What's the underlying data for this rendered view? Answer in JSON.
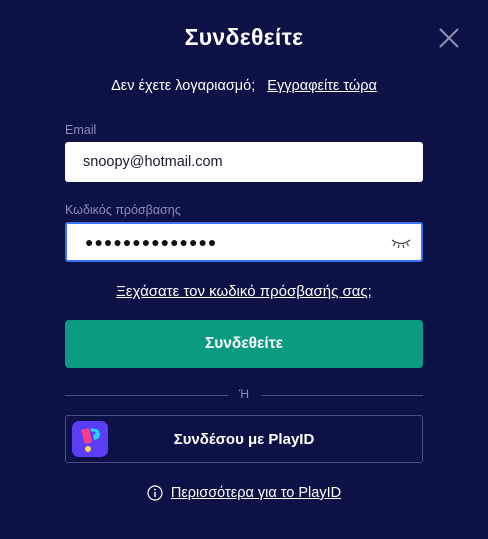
{
  "modal": {
    "title": "Συνδεθείτε",
    "close_icon": "close-icon"
  },
  "signup": {
    "question": "Δεν έχετε λογαριασμό;",
    "link": "Εγγραφείτε τώρα"
  },
  "email": {
    "label": "Email",
    "value": "snoopy@hotmail.com"
  },
  "password": {
    "label": "Κωδικός πρόσβασης",
    "masked_value": "●●●●●●●●●●●●●●",
    "toggle_icon": "eye-closed-icon"
  },
  "forgot_link": "Ξεχάσατε τον κωδικό πρόσβασής σας;",
  "login_button": "Συνδεθείτε",
  "divider": "Ή",
  "playid": {
    "button_label": "Συνδέσου με PlayID",
    "logo_icon": "playid-logo-icon"
  },
  "more_info": {
    "icon": "info-icon",
    "link": "Περισσότερα για το PlayID"
  },
  "colors": {
    "background": "#0e1145",
    "primary_button": "#0b9b83",
    "focus_border": "#3b74ee",
    "muted_text": "#8d8fb3",
    "playid_logo_bg": "#5b3df5"
  }
}
